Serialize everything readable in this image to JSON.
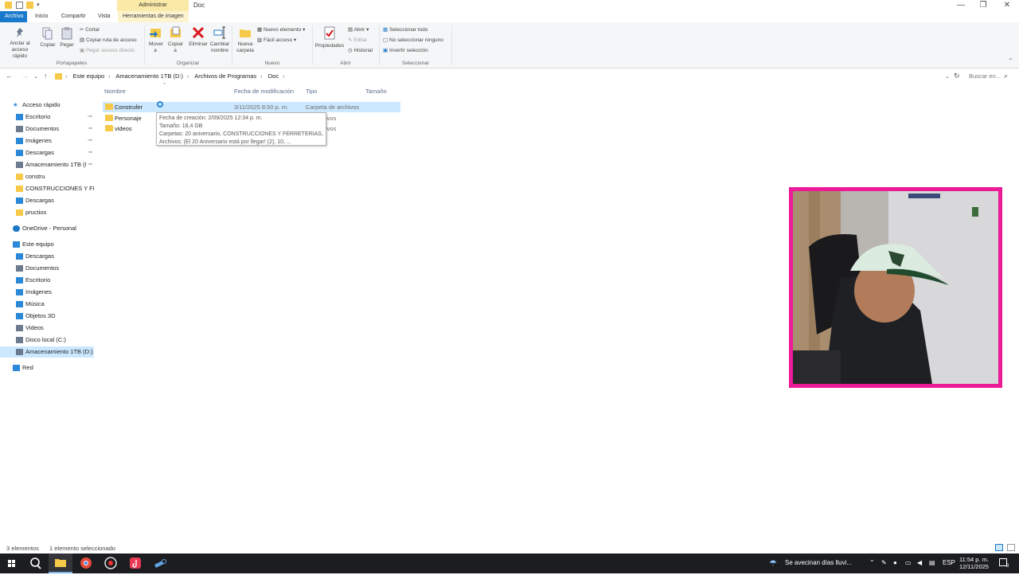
{
  "window": {
    "context_tab": "Administrar",
    "title": "Doc",
    "minimize": "—",
    "maximize": "❐",
    "close": "✕"
  },
  "ribbon_tabs": [
    "Archivo",
    "Inicio",
    "Compartir",
    "Vista",
    "Herramientas de imagen"
  ],
  "ribbon": {
    "clipboard": {
      "pin": "Anclar al acceso rápido",
      "copy": "Copiar",
      "paste": "Pegar",
      "cut": "Cortar",
      "copy_path": "Copiar ruta de acceso",
      "paste_shortcut": "Pegar acceso directo",
      "label": "Portapapeles"
    },
    "organize": {
      "move": "Mover a",
      "copy_to": "Copiar a",
      "delete": "Eliminar",
      "rename": "Cambiar nombre",
      "label": "Organizar"
    },
    "new": {
      "new_folder": "Nueva carpeta",
      "new_item": "Nuevo elemento",
      "easy_access": "Fácil acceso",
      "label": "Nuevo"
    },
    "open": {
      "properties": "Propiedades",
      "open": "Abrir",
      "edit": "Editar",
      "history": "Historial",
      "label": "Abrir"
    },
    "select": {
      "select_all": "Seleccionar todo",
      "select_none": "No seleccionar ninguno",
      "invert": "Invertir selección",
      "label": "Seleccionar"
    }
  },
  "address": {
    "crumbs": [
      "Este equipo",
      "Amacenamiento 1TB (D:)",
      "Archivos de Programas",
      "Doc"
    ],
    "search_placeholder": "Buscar en..."
  },
  "nav_items": [
    {
      "label": "Acceso rápido",
      "icon": "star-icon",
      "level": 0,
      "pinned": false
    },
    {
      "label": "Escritorio",
      "icon": "desktop-icon",
      "level": 1,
      "pinned": true
    },
    {
      "label": "Documentos",
      "icon": "documents-icon",
      "level": 1,
      "pinned": true
    },
    {
      "label": "Imágenes",
      "icon": "pictures-icon",
      "level": 1,
      "pinned": true
    },
    {
      "label": "Descargas",
      "icon": "downloads-icon",
      "level": 1,
      "pinned": true
    },
    {
      "label": "Amacenamiento 1TB (I",
      "icon": "drive-icon",
      "level": 1,
      "pinned": true
    },
    {
      "label": "constru",
      "icon": "folder-icon",
      "level": 1,
      "pinned": false
    },
    {
      "label": "CONSTRUCCIONES Y FERF",
      "icon": "folder-icon",
      "level": 1,
      "pinned": false
    },
    {
      "label": "Descargas",
      "icon": "downloads-icon",
      "level": 1,
      "pinned": false
    },
    {
      "label": "pructios",
      "icon": "folder-icon",
      "level": 1,
      "pinned": false
    },
    {
      "label": "OneDrive - Personal",
      "icon": "cloud-icon",
      "level": 0,
      "pinned": false
    },
    {
      "label": "Este equipo",
      "icon": "pc-icon",
      "level": 0,
      "pinned": false
    },
    {
      "label": "Descargas",
      "icon": "downloads-icon",
      "level": 1,
      "pinned": false
    },
    {
      "label": "Documentos",
      "icon": "documents-icon",
      "level": 1,
      "pinned": false
    },
    {
      "label": "Escritorio",
      "icon": "desktop-icon",
      "level": 1,
      "pinned": false
    },
    {
      "label": "Imágenes",
      "icon": "pictures-icon",
      "level": 1,
      "pinned": false
    },
    {
      "label": "Música",
      "icon": "music-icon",
      "level": 1,
      "pinned": false
    },
    {
      "label": "Objetos 3D",
      "icon": "cube-icon",
      "level": 1,
      "pinned": false
    },
    {
      "label": "Videos",
      "icon": "videos-icon",
      "level": 1,
      "pinned": false
    },
    {
      "label": "Disco local (C:)",
      "icon": "drive-icon",
      "level": 1,
      "pinned": false
    },
    {
      "label": "Amacenamiento 1TB (D:)",
      "icon": "drive-icon",
      "level": 1,
      "pinned": false,
      "selected": true
    },
    {
      "label": "Red",
      "icon": "network-icon",
      "level": 0,
      "pinned": false
    }
  ],
  "columns": [
    "Nombre",
    "Fecha de modificación",
    "Tipo",
    "Tamaño"
  ],
  "files": [
    {
      "name": "Construfer",
      "date": "3/11/2025 8:50 p. m.",
      "type": "Carpeta de archivos",
      "selected": true
    },
    {
      "name": "Personaje",
      "date": "",
      "type": "de archivos",
      "selected": false
    },
    {
      "name": "videos",
      "date": "",
      "type": "de archivos",
      "selected": false
    }
  ],
  "tooltip": [
    "Fecha de creación: 2/09/2025 12:34 p. m.",
    "Tamaño: 18,4 GB",
    "Carpetas: 20 aniversario, CONSTRUCCIONES Y FERRETERIAS, ...",
    "Archivos: (El 20 Aniversario está por llegar! (2), 10, ..."
  ],
  "status": {
    "count": "3 elementos",
    "selection": "1 elemento seleccionado"
  },
  "taskbar": {
    "weather": "Se avecinan días lluvi...",
    "lang": "ESP",
    "time": "11:54 p. m.",
    "date": "12/11/2025",
    "notifications": "3"
  },
  "colors": {
    "accent": "#1979ca",
    "selection": "#cce8ff",
    "webcam_border": "#ec1a96",
    "taskbar": "#1c1d21"
  }
}
